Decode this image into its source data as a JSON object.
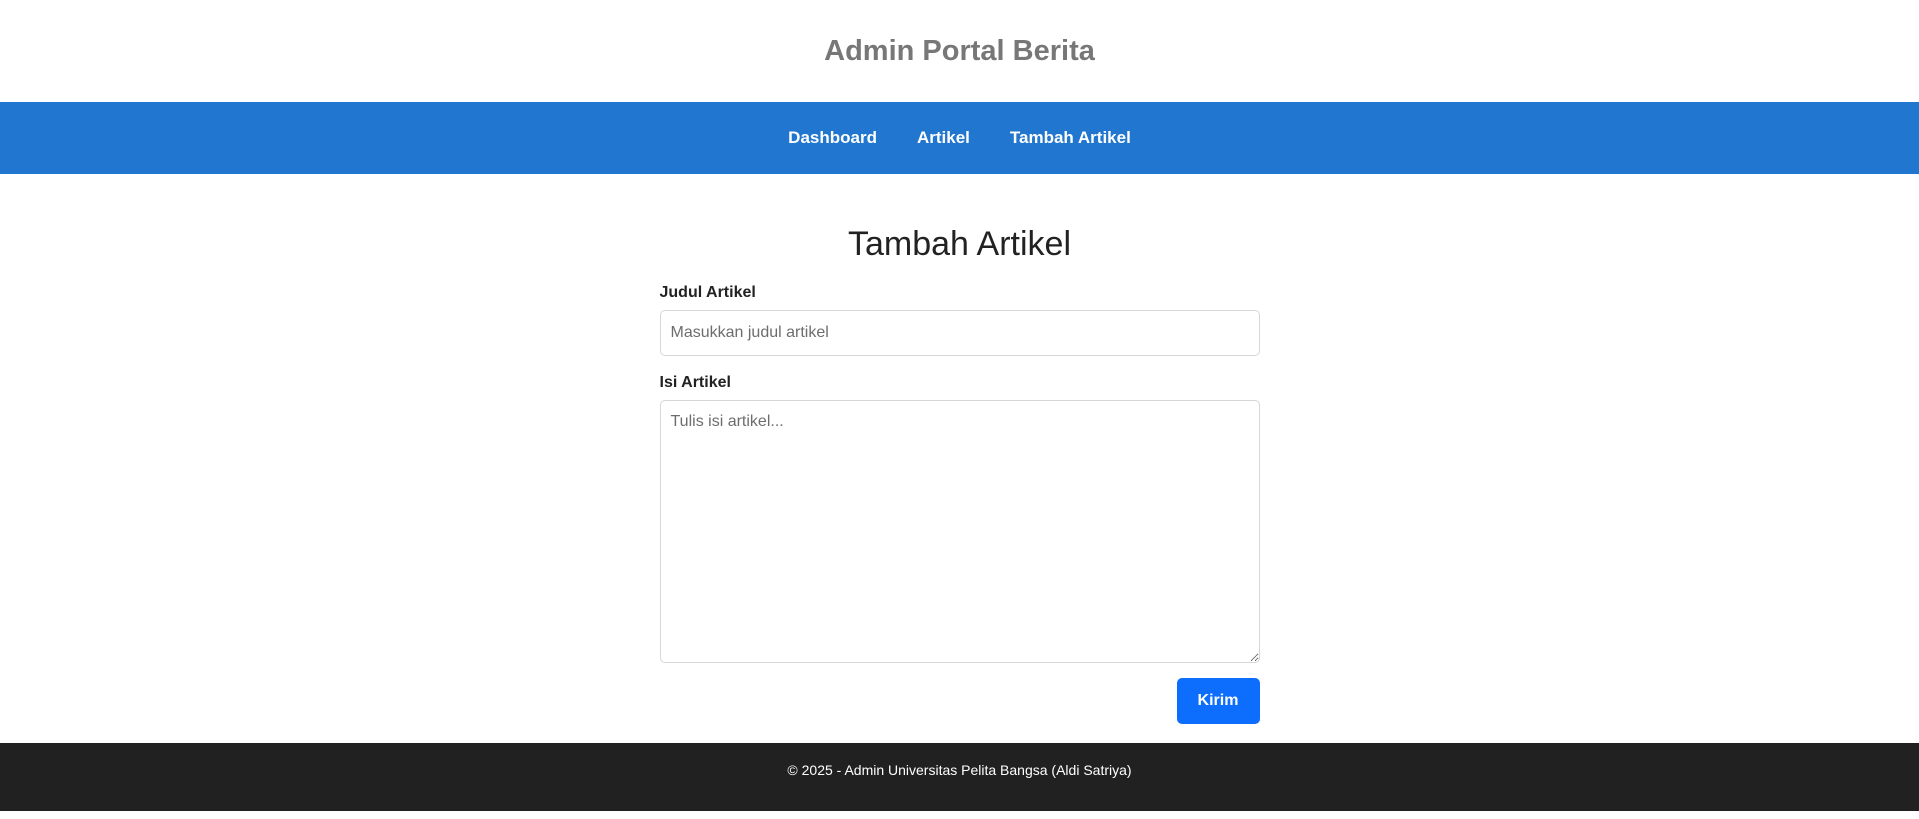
{
  "header": {
    "title": "Admin Portal Berita"
  },
  "nav": {
    "items": [
      {
        "label": "Dashboard"
      },
      {
        "label": "Artikel"
      },
      {
        "label": "Tambah Artikel"
      }
    ]
  },
  "main": {
    "page_title": "Tambah Artikel",
    "form": {
      "title_label": "Judul Artikel",
      "title_placeholder": "Masukkan judul artikel",
      "title_value": "",
      "content_label": "Isi Artikel",
      "content_placeholder": "Tulis isi artikel...",
      "content_value": "",
      "submit_label": "Kirim"
    }
  },
  "footer": {
    "text": "© 2025 - Admin Universitas Pelita Bangsa (Aldi Satriya)"
  },
  "colors": {
    "nav_background": "#2176cf",
    "submit_button": "#0d6efd",
    "footer_background": "#212121",
    "site_title": "#777777"
  }
}
